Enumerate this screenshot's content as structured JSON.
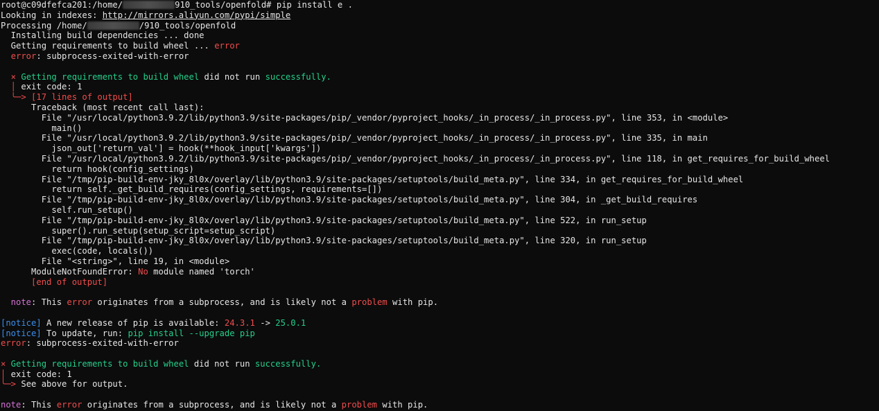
{
  "prompt": {
    "user_host": "root@c09dfefca201:/home/",
    "path_rest": "910_tools/openfold#",
    "command": " pip install e ."
  },
  "looking_in": {
    "label": "Looking in indexes: ",
    "url": "http://mirrors.aliyun.com/pypi/simple"
  },
  "processing": {
    "label": "Processing /home/",
    "path_rest": "/910_tools/openfold"
  },
  "install_deps": "  Installing build dependencies ... done",
  "getting_reqs": {
    "text": "  Getting requirements to build wheel ... ",
    "status": "error"
  },
  "error1": {
    "prefix": "  error",
    "text": ": subprocess-exited-with-error"
  },
  "block1": {
    "x": "  ×",
    "getting": " Getting requirements to build wheel",
    "did_not": " did not run ",
    "success": "successfully.",
    "exit_bar": "  │",
    "exit_text": " exit code: 1",
    "arrow": "  ╰─> [17 lines of output]"
  },
  "traceback": [
    "      Traceback (most recent call last):",
    "        File \"/usr/local/python3.9.2/lib/python3.9/site-packages/pip/_vendor/pyproject_hooks/_in_process/_in_process.py\", line 353, in <module>",
    "          main()",
    "        File \"/usr/local/python3.9.2/lib/python3.9/site-packages/pip/_vendor/pyproject_hooks/_in_process/_in_process.py\", line 335, in main",
    "          json_out['return_val'] = hook(**hook_input['kwargs'])",
    "        File \"/usr/local/python3.9.2/lib/python3.9/site-packages/pip/_vendor/pyproject_hooks/_in_process/_in_process.py\", line 118, in get_requires_for_build_wheel",
    "          return hook(config_settings)",
    "        File \"/tmp/pip-build-env-jky_8l0x/overlay/lib/python3.9/site-packages/setuptools/build_meta.py\", line 334, in get_requires_for_build_wheel",
    "          return self._get_build_requires(config_settings, requirements=[])",
    "        File \"/tmp/pip-build-env-jky_8l0x/overlay/lib/python3.9/site-packages/setuptools/build_meta.py\", line 304, in _get_build_requires",
    "          self.run_setup()",
    "        File \"/tmp/pip-build-env-jky_8l0x/overlay/lib/python3.9/site-packages/setuptools/build_meta.py\", line 522, in run_setup",
    "          super().run_setup(setup_script=setup_script)",
    "        File \"/tmp/pip-build-env-jky_8l0x/overlay/lib/python3.9/site-packages/setuptools/build_meta.py\", line 320, in run_setup",
    "          exec(code, locals())",
    "        File \"<string>\", line 19, in <module>"
  ],
  "module_error": {
    "prefix": "      ModuleNotFoundError: ",
    "red": "No",
    "rest": " module named 'torch'"
  },
  "end_output": "      [end of output]",
  "note1": {
    "label": "  note",
    "t1": ": This ",
    "error": "error",
    "t2": " originates from a subprocess, and is likely not a ",
    "problem": "problem",
    "t3": " with pip."
  },
  "notice1": {
    "tag": "[notice]",
    "text": " A new release of pip is available: ",
    "old": "24.3.1",
    "arrow": " -> ",
    "new": "25.0.1"
  },
  "notice2": {
    "tag": "[notice]",
    "text": " To update, run: ",
    "cmd": "pip install --upgrade pip"
  },
  "error2": {
    "prefix": "error",
    "text": ": subprocess-exited-with-error"
  },
  "block2": {
    "x": "×",
    "getting": " Getting requirements to build wheel",
    "did_not": " did not run ",
    "success": "successfully.",
    "exit_bar": "│",
    "exit_text": " exit code: 1",
    "arrow": "╰─>",
    "see_above": " See above for output."
  },
  "note2": {
    "label": "note",
    "t1": ": This ",
    "error": "error",
    "t2": " originates from a subprocess, and is likely not a ",
    "problem": "problem",
    "t3": " with pip."
  },
  "colors": {
    "background": "#0c0c0c",
    "text": "#e6e6e6",
    "error": "#f14c4c",
    "success": "#23d18b",
    "notice": "#3b8eea",
    "note": "#d670d6"
  }
}
